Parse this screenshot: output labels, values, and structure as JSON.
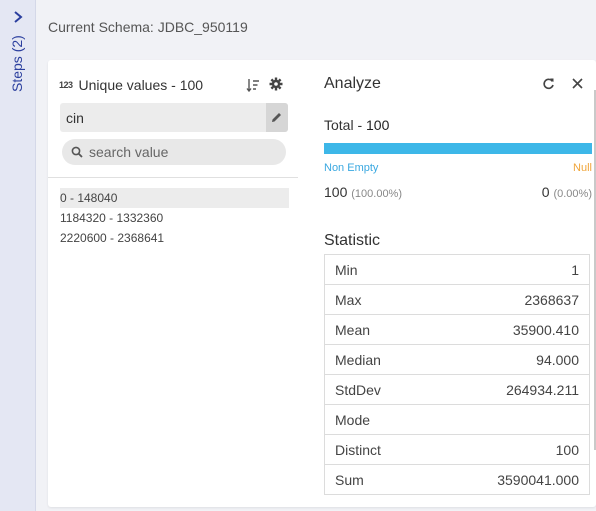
{
  "steps": {
    "label": "Steps (2)"
  },
  "schema": {
    "label": "Current Schema: JDBC_950119"
  },
  "unique_values": {
    "type_badge": "123",
    "title": "Unique values - 100",
    "column_value": "cin",
    "search_placeholder": "search value",
    "items": [
      "0 - 148040",
      "1184320 - 1332360",
      "2220600 - 2368641"
    ]
  },
  "analyze": {
    "title": "Analyze",
    "total_label": "Total - ",
    "total_value": "100",
    "non_empty_label": "Non Empty",
    "null_label": "Null",
    "non_empty_fraction": 1.0,
    "non_empty_count": "100",
    "non_empty_pct": "(100.00%)",
    "null_count": "0",
    "null_pct": "(0.00%)",
    "statistic_title": "Statistic",
    "stats": [
      {
        "label": "Min",
        "value": "1"
      },
      {
        "label": "Max",
        "value": "2368637"
      },
      {
        "label": "Mean",
        "value": "35900.410"
      },
      {
        "label": "Median",
        "value": "94.000"
      },
      {
        "label": "StdDev",
        "value": "264934.211"
      },
      {
        "label": "Mode",
        "value": ""
      },
      {
        "label": "Distinct",
        "value": "100"
      },
      {
        "label": "Sum",
        "value": "3590041.000"
      }
    ]
  },
  "colors": {
    "accent": "#2b3f9e",
    "non_empty": "#3db7e8",
    "null": "#f7b64b"
  },
  "icons": [
    "chevron-right-icon",
    "sort-icon",
    "gear-icon",
    "pencil-icon",
    "search-icon",
    "refresh-icon",
    "close-icon"
  ]
}
